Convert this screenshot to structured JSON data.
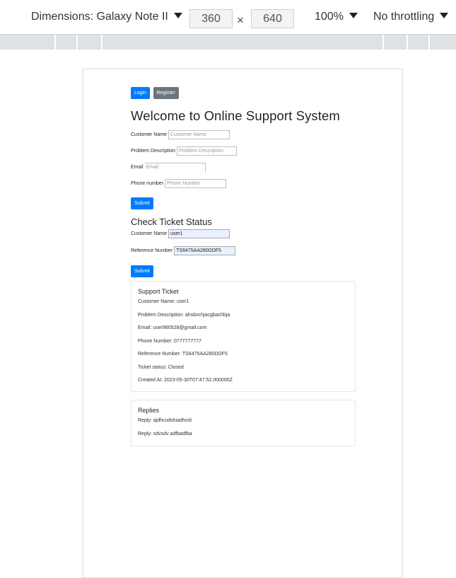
{
  "devtools": {
    "dimensions_label": "Dimensions: Galaxy Note II",
    "width_value": "360",
    "times": "×",
    "height_value": "640",
    "zoom": "100%",
    "throttling": "No throttling"
  },
  "nav": {
    "login_label": "Login",
    "register_label": "Register"
  },
  "page_title": "Welcome to Online Support System",
  "form": {
    "name_label": "Customer Name",
    "name_placeholder": "Customer Name",
    "problem_label": "Problem Description",
    "problem_placeholder": "Problem Description",
    "email_label": "Email",
    "email_placeholder": "Email",
    "phone_label": "Phone number",
    "phone_placeholder": "Phone Number",
    "submit_label": "Submit"
  },
  "status": {
    "title": "Check Ticket Status",
    "name_label": "Customer Name",
    "name_value": "user1",
    "ref_label": "Reference Number",
    "ref_value": "TS6475AA280DDF5",
    "submit_label": "Submit"
  },
  "ticket": {
    "title": "Support Ticket",
    "lines": [
      "Customer Name: user1",
      "Problem Description: ahsbxchjacgbachbja",
      "Email: user980528@gmail.com",
      "Phone Number: 0777777777",
      "Reference Number: TS6475AA280DDF5",
      "Ticket status: Closed",
      "Created At: 2023-05-30T07:47:52.000000Z"
    ]
  },
  "replies": {
    "title": "Replies",
    "lines": [
      "Reply: ajdhcudshiadhcid",
      "Reply: sdvsdv adfbadfba"
    ]
  }
}
